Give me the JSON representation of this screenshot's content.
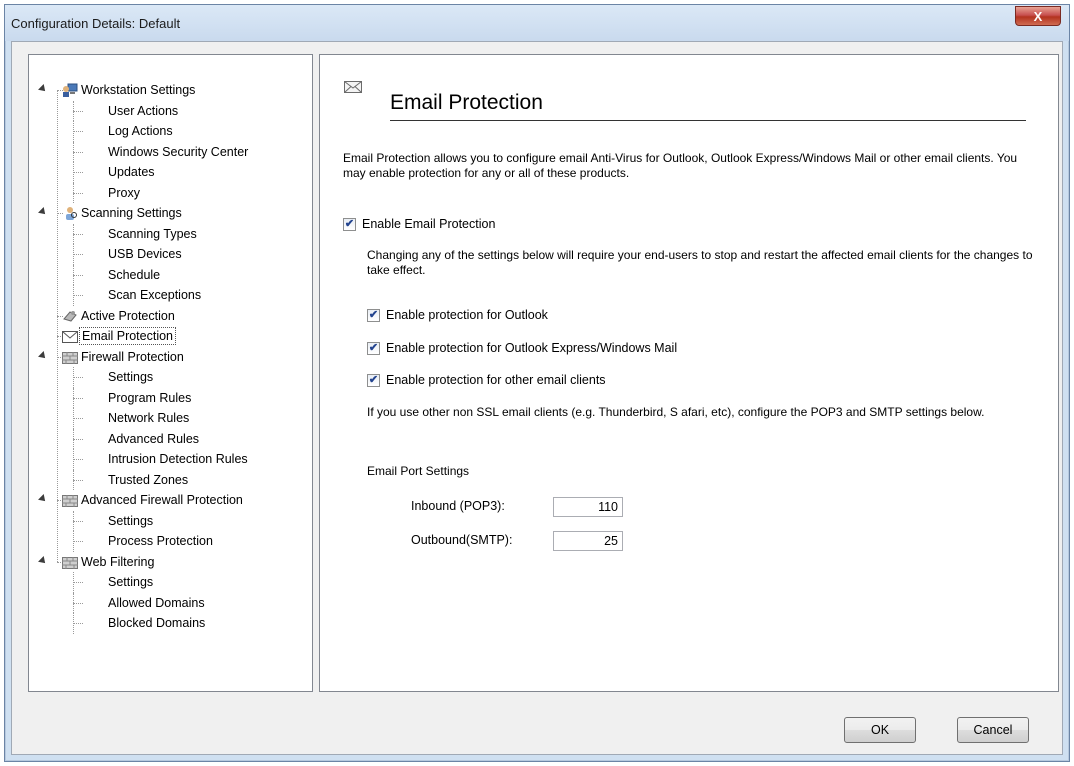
{
  "window": {
    "title": "Configuration Details: Default",
    "close_glyph": "X"
  },
  "tree": [
    {
      "label": "Workstation Settings",
      "level": 0,
      "icon": "workstation-icon",
      "expanded": true
    },
    {
      "label": "User Actions",
      "level": 1
    },
    {
      "label": "Log Actions",
      "level": 1
    },
    {
      "label": "Windows Security Center",
      "level": 1
    },
    {
      "label": "Updates",
      "level": 1
    },
    {
      "label": "Proxy",
      "level": 1
    },
    {
      "label": "Scanning Settings",
      "level": 0,
      "icon": "scanning-icon",
      "expanded": true
    },
    {
      "label": "Scanning Types",
      "level": 1
    },
    {
      "label": "USB Devices",
      "level": 1
    },
    {
      "label": "Schedule",
      "level": 1
    },
    {
      "label": "Scan Exceptions",
      "level": 1
    },
    {
      "label": "Active Protection",
      "level": 0,
      "icon": "active-protection-icon"
    },
    {
      "label": "Email Protection",
      "level": 0,
      "icon": "envelope-icon",
      "selected": true
    },
    {
      "label": "Firewall Protection",
      "level": 0,
      "icon": "firewall-icon",
      "expanded": true
    },
    {
      "label": "Settings",
      "level": 1
    },
    {
      "label": "Program Rules",
      "level": 1
    },
    {
      "label": "Network Rules",
      "level": 1
    },
    {
      "label": "Advanced Rules",
      "level": 1
    },
    {
      "label": "Intrusion Detection Rules",
      "level": 1
    },
    {
      "label": "Trusted Zones",
      "level": 1
    },
    {
      "label": "Advanced Firewall Protection",
      "level": 0,
      "icon": "firewall-icon",
      "expanded": true
    },
    {
      "label": "Settings",
      "level": 1
    },
    {
      "label": "Process Protection",
      "level": 1
    },
    {
      "label": "Web Filtering",
      "level": 0,
      "icon": "firewall-icon",
      "expanded": true
    },
    {
      "label": "Settings",
      "level": 1
    },
    {
      "label": "Allowed Domains",
      "level": 1
    },
    {
      "label": "Blocked Domains",
      "level": 1
    }
  ],
  "main": {
    "heading": "Email Protection",
    "description": "Email Protection allows you to configure email Anti-Virus for Outlook, Outlook Express/Windows Mail or other email clients. You may enable protection for any or all of these products.",
    "enable_label": "Enable Email Protection",
    "enable_checked": true,
    "restart_note": "Changing any of the settings below will require your end-users to stop and restart the affected email clients for the changes to take effect.",
    "options": [
      {
        "label": "Enable protection for Outlook",
        "checked": true
      },
      {
        "label": "Enable protection for Outlook Express/Windows Mail",
        "checked": true
      },
      {
        "label": "Enable protection for other email clients",
        "checked": true
      }
    ],
    "ssl_note": "If you use other non SSL email clients (e.g. Thunderbird, S afari, etc), configure the POP3 and SMTP settings below.",
    "port_settings_title": "Email Port Settings",
    "inbound_label": "Inbound (POP3):",
    "inbound_value": "110",
    "outbound_label": "Outbound(SMTP):",
    "outbound_value": "25"
  },
  "buttons": {
    "ok": "OK",
    "cancel": "Cancel"
  },
  "check_glyph": "✔"
}
